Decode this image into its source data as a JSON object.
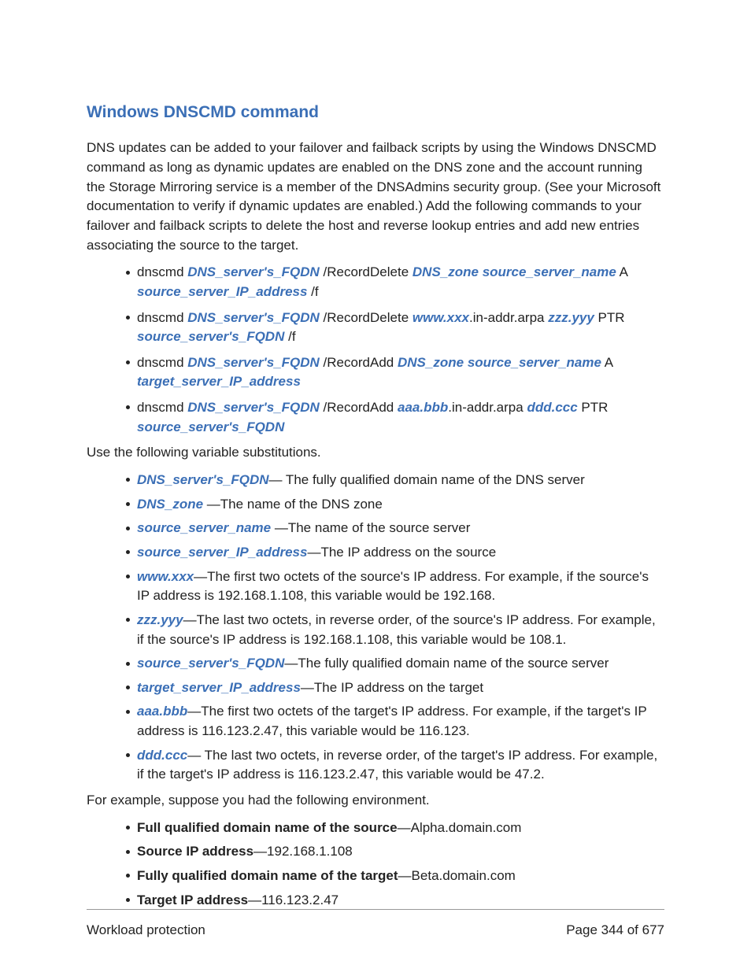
{
  "heading": "Windows DNSCMD command",
  "intro": "DNS updates can be added to your failover and failback scripts by using the Windows DNSCMD command as long as dynamic updates are enabled on the DNS zone and the account running the Storage Mirroring service is a member of the DNSAdmins security group. (See your Microsoft documentation to verify if dynamic updates are enabled.) Add the following commands to your failover and failback scripts to delete the host and reverse lookup entries and add new entries associating the source to the target.",
  "commands": [
    {
      "prefix": "dnscmd ",
      "v1": "DNS_server's_FQDN",
      "mid1": " /RecordDelete ",
      "v2": "DNS_zone",
      "sp1": " ",
      "v3": "source_server_name",
      "mid2": " A ",
      "v4": "source_server_IP_address",
      "suffix": " /f"
    },
    {
      "prefix": "dnscmd ",
      "v1": "DNS_server's_FQDN",
      "mid1": " /RecordDelete ",
      "v2": "www.xxx",
      "sp1": ".in-addr.arpa ",
      "v3": "zzz.yyy",
      "mid2": " PTR ",
      "v4": "source_server's_FQDN",
      "suffix": " /f"
    },
    {
      "prefix": "dnscmd ",
      "v1": "DNS_server's_FQDN",
      "mid1": " /RecordAdd ",
      "v2": "DNS_zone",
      "sp1": " ",
      "v3": "source_server_name",
      "mid2": " A ",
      "v4": "target_server_IP_address",
      "suffix": ""
    },
    {
      "prefix": "dnscmd ",
      "v1": "DNS_server's_FQDN",
      "mid1": " /RecordAdd ",
      "v2": "aaa.bbb",
      "sp1": ".in-addr.arpa ",
      "v3": "ddd.ccc",
      "mid2": " PTR ",
      "v4": "source_server's_FQDN",
      "suffix": ""
    }
  ],
  "subsIntro": "Use the following variable substitutions.",
  "subs": [
    {
      "var": "DNS_server's_FQDN",
      "desc": "— The fully qualified domain name of the DNS server"
    },
    {
      "var": "DNS_zone",
      "desc": " —The name of the DNS zone"
    },
    {
      "var": "source_server_name",
      "desc": " —The name of the source server"
    },
    {
      "var": "source_server_IP_address",
      "desc": "—The IP address on the source"
    },
    {
      "var": "www.xxx",
      "desc": "—The first two octets of the source's IP address. For example, if the source's IP address is 192.168.1.108, this variable would be 192.168."
    },
    {
      "var": "zzz.yyy",
      "desc": "—The last two octets, in reverse order, of the source's IP address. For example, if the source's IP address is 192.168.1.108, this variable would be 108.1."
    },
    {
      "var": "source_server's_FQDN",
      "desc": "—The fully qualified domain name of the source server"
    },
    {
      "var": "target_server_IP_address",
      "desc": "—The IP address on the target"
    },
    {
      "var": "aaa.bbb",
      "desc": "—The first two octets of the target's IP address. For example, if the target's IP address is 116.123.2.47, this variable would be 116.123."
    },
    {
      "var": "ddd.ccc",
      "desc": "— The last two octets, in reverse order, of the target's IP address. For example, if the target's IP address is 116.123.2.47, this variable would be 47.2."
    }
  ],
  "exampleIntro": "For example, suppose you had the following environment.",
  "env": [
    {
      "label": "Full qualified domain name of the source",
      "value": "—Alpha.domain.com"
    },
    {
      "label": "Source IP address",
      "value": "—192.168.1.108"
    },
    {
      "label": "Fully qualified domain name of the target",
      "value": "—Beta.domain.com"
    },
    {
      "label": "Target IP address",
      "value": "—116.123.2.47"
    }
  ],
  "footer": {
    "left": "Workload protection",
    "right": "Page 344 of 677"
  }
}
